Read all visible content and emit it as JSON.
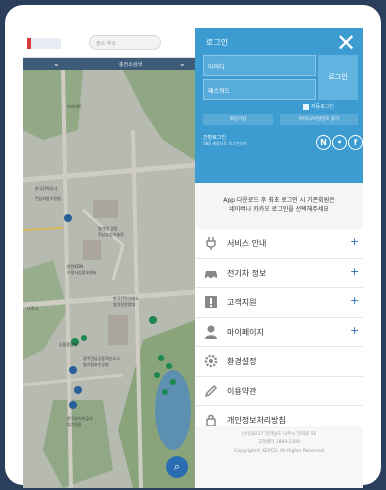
{
  "header": {
    "search_placeholder": "장소 주소"
  },
  "map_toolbar": {
    "label": "충전소검색"
  },
  "map": {
    "labels": [
      "우리마트",
      "한국전력공사",
      "전남지방우정청",
      "빛가람 광장",
      "전남농업기술원",
      "한전KDN",
      "우정사업정보센터",
      "한국전력거래소",
      "빛가람전망대",
      "광주전남공동혁신도시",
      "빛가람호수공원",
      "농협중앙회",
      "한국농어촌공사",
      "빛가람동",
      "나주시"
    ]
  },
  "login": {
    "title": "로그인",
    "id_placeholder": "아이디",
    "pw_placeholder": "패스워드",
    "login_button": "로그인",
    "auto_login": "자동로그인",
    "join": "회원가입",
    "find": "아이디/비밀번호 찾기",
    "easy_title": "간편로그인",
    "easy_sub": "SNS 계정으로 로그인하기"
  },
  "notice": {
    "line1": "App 다운로드 후 최초 로그인 시 기존회원은",
    "line2": "네이버나 카카오 로그인을 선택해주세요"
  },
  "menu": [
    {
      "label": "서비스 안내",
      "icon": "plug-icon",
      "expandable": true
    },
    {
      "label": "전기차 정보",
      "icon": "car-icon",
      "expandable": true
    },
    {
      "label": "고객지원",
      "icon": "alert-icon",
      "expandable": true
    },
    {
      "label": "마이페이지",
      "icon": "user-icon",
      "expandable": true
    },
    {
      "label": "환경설정",
      "icon": "gear-icon",
      "expandable": false
    },
    {
      "label": "이용약관",
      "icon": "pen-icon",
      "expandable": false
    },
    {
      "label": "개인정보처리방침",
      "icon": "lock-icon",
      "expandable": false
    }
  ],
  "footer": {
    "line1": "(우)58217 전라남도 나주시 전력로 55",
    "line2": "고객센터 1899-2100",
    "line3": "Copyright© KEPCO. All Rights Reserved"
  },
  "colors": {
    "login_bg": "#3c9bd0",
    "accent": "#2a6db3",
    "frame_bg": "#2b3f5c"
  }
}
